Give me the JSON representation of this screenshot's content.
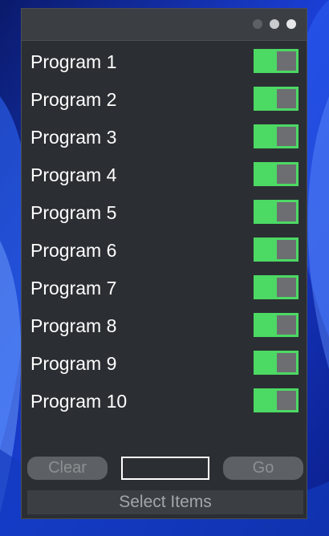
{
  "window": {
    "controls": [
      {
        "name": "minimize-dot",
        "color": "#5d6165"
      },
      {
        "name": "maximize-dot",
        "color": "#c9cbcd"
      },
      {
        "name": "close-dot",
        "color": "#e6e7e8"
      }
    ]
  },
  "programs": [
    {
      "label": "Program 1",
      "enabled": true
    },
    {
      "label": "Program 2",
      "enabled": true
    },
    {
      "label": "Program 3",
      "enabled": true
    },
    {
      "label": "Program 4",
      "enabled": true
    },
    {
      "label": "Program 5",
      "enabled": true
    },
    {
      "label": "Program 6",
      "enabled": true
    },
    {
      "label": "Program 7",
      "enabled": true
    },
    {
      "label": "Program 8",
      "enabled": true
    },
    {
      "label": "Program 9",
      "enabled": true
    },
    {
      "label": "Program 10",
      "enabled": true
    }
  ],
  "toggle_on_color": "#4cd964",
  "footer": {
    "clear_label": "Clear",
    "input_value": "",
    "go_label": "Go",
    "select_label": "Select Items"
  }
}
